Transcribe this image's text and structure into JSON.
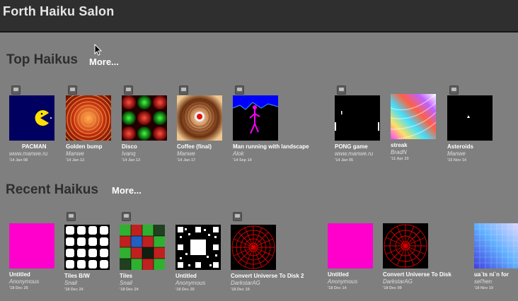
{
  "header": {
    "title": "Forth Haiku Salon"
  },
  "top": {
    "title": "Top Haikus",
    "more_label": "More...",
    "items": [
      {
        "title": "PACMAN",
        "author": "www.manwe.ru",
        "date": "'14 Jan 08"
      },
      {
        "title": "Golden bump",
        "author": "Manwe",
        "date": "'14 Jan 13"
      },
      {
        "title": "Disco",
        "author": "Ivanq",
        "date": "'14 Jan 13"
      },
      {
        "title": "Coffee (final)",
        "author": "Manwe",
        "date": "'14 Jan 17"
      },
      {
        "title": "Man running with landscape",
        "author": "Alok",
        "date": "'14 Sep 14"
      },
      {
        "title": "PONG game",
        "author": "www.manwe.ru",
        "date": "'14 Jan 05"
      },
      {
        "title": "streak",
        "author": "BradN",
        "date": "'11 Apr 23"
      },
      {
        "title": "Asteroids",
        "author": "Manwe",
        "date": "'15 Nov 14"
      }
    ]
  },
  "recent": {
    "title": "Recent Haikus",
    "more_label": "More...",
    "items": [
      {
        "title": "Untitled",
        "author": "Anonymous",
        "date": "'18 Dec 25"
      },
      {
        "title": "Tiles B/W",
        "author": "Snail",
        "date": "'18 Dec 24"
      },
      {
        "title": "Tiles",
        "author": "Snail",
        "date": "'18 Dec 24"
      },
      {
        "title": "Untitled",
        "author": "Anonymous",
        "date": "'18 Dec 20"
      },
      {
        "title": "Convert Universe To Disk 2",
        "author": "DarkstarAG",
        "date": "'18 Dec 19"
      },
      {
        "title": "Untitled",
        "author": "Anonymous",
        "date": "'18 Dec 14"
      },
      {
        "title": "Convert Universe To Disk",
        "author": "DarkstarAG",
        "date": "'18 Dec 09"
      },
      {
        "title": "ua`ts ni`n for",
        "author": "sel'hen",
        "date": "'18 Nov 19"
      }
    ]
  },
  "colors": {
    "accent_magenta": "#ff00cc",
    "header_bg": "#2f2f2f",
    "page_bg": "#7f7f7f"
  }
}
